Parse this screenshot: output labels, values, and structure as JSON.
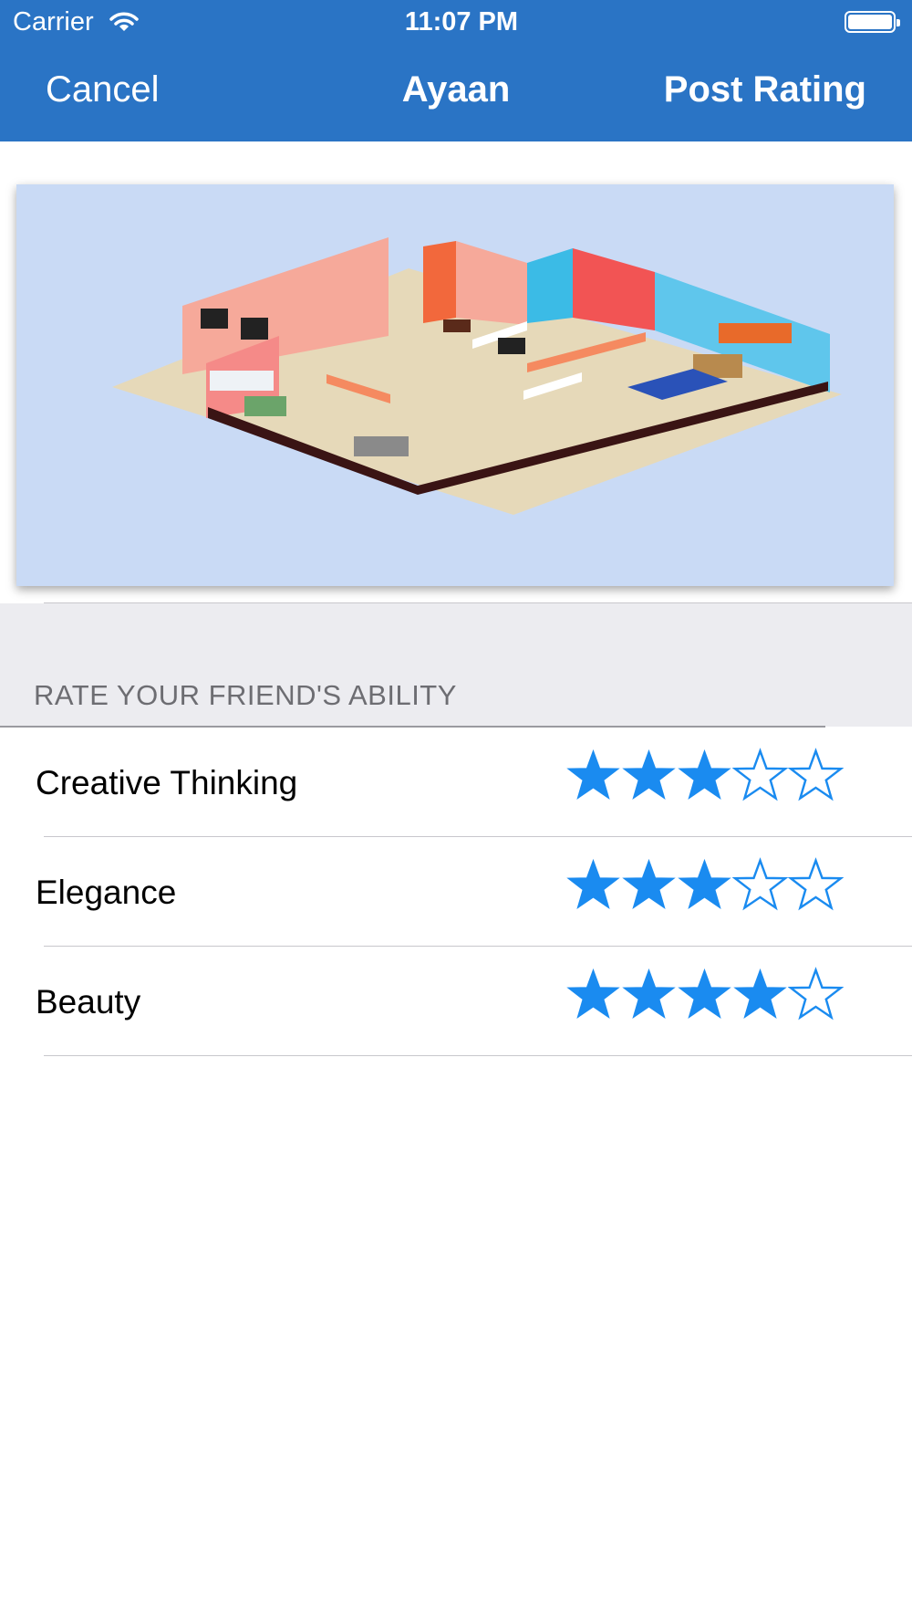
{
  "status_bar": {
    "carrier": "Carrier",
    "time": "11:07 PM"
  },
  "nav": {
    "cancel_label": "Cancel",
    "title": "Ayaan",
    "post_label": "Post Rating"
  },
  "section": {
    "header": "RATE YOUR FRIEND'S ABILITY"
  },
  "ratings": [
    {
      "label": "Creative Thinking",
      "rating": 3,
      "max": 5
    },
    {
      "label": "Elegance",
      "rating": 3,
      "max": 5
    },
    {
      "label": "Beauty",
      "rating": 4,
      "max": 5
    }
  ],
  "colors": {
    "nav_bar": "#2a74c5",
    "star": "#1a8bf0",
    "image_background": "#c9daf5"
  },
  "icons": {
    "wifi": "wifi-icon",
    "battery": "battery-icon",
    "star_filled": "star-filled-icon",
    "star_empty": "star-empty-icon"
  }
}
